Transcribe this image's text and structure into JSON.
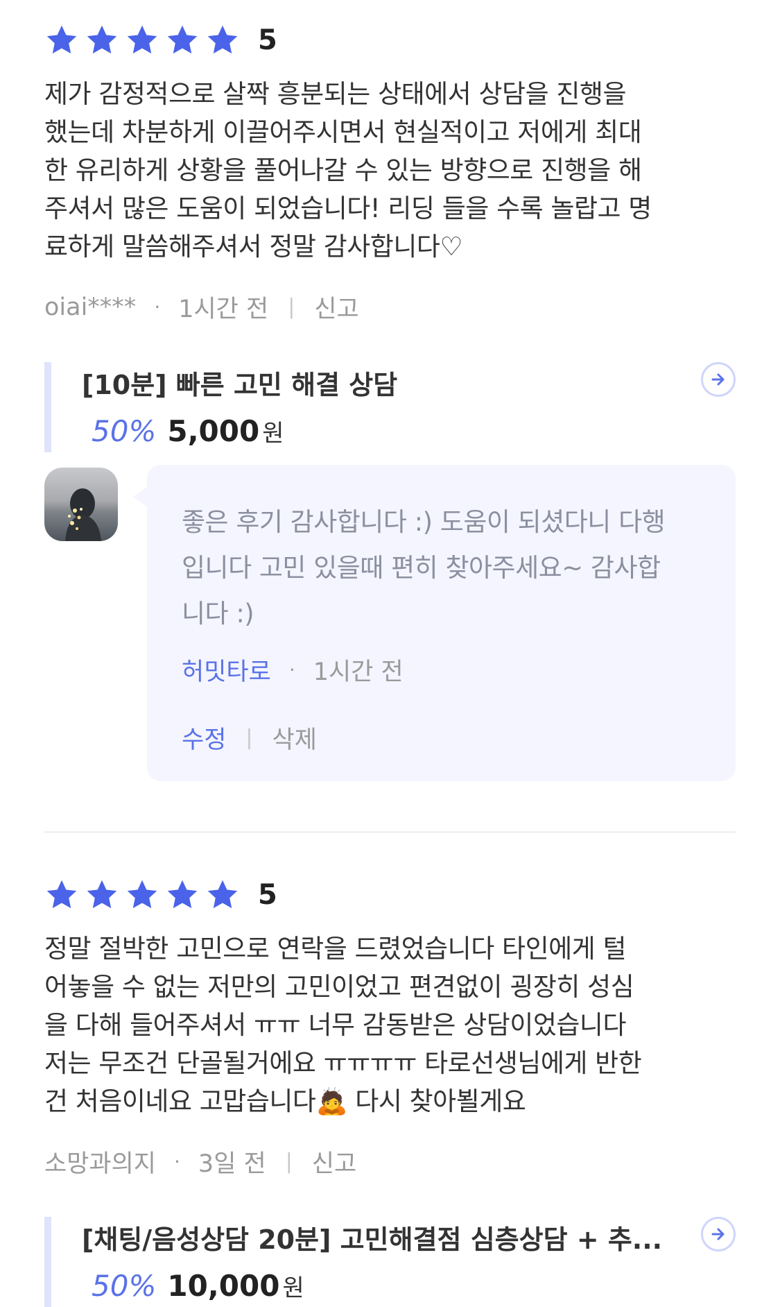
{
  "colors": {
    "star": "#4a63e8",
    "accent": "#5a72e8",
    "reply_bg": "#f4f5fe",
    "card_bar": "#dfe3fb"
  },
  "reviews": [
    {
      "stars": 5,
      "rating_label": "5",
      "text_lines": [
        "제가 감정적으로 살짝 흥분되는 상태에서 상담을 진행을",
        "했는데 차분하게 이끌어주시면서 현실적이고 저에게 최대",
        "한 유리하게 상황을 풀어나갈 수 있는 방향으로 진행을 해",
        "주셔서 많은 도움이 되었습니다! 리딩 들을 수록 놀랍고 명",
        "료하게 말씀해주셔서 정말 감사합니다♡"
      ],
      "author": "oiai****",
      "time": "1시간 전",
      "report_label": "신고",
      "product": {
        "title": "[10분] 빠른 고민 해결 상담",
        "discount": "50%",
        "price": "5,000",
        "currency": "원",
        "arrow_icon": "arrow-right-circle-icon"
      }
    },
    {
      "stars": 5,
      "rating_label": "5",
      "text_lines": [
        "정말 절박한 고민으로 연락을 드렸었습니다 타인에게 털",
        "어놓을 수 없는 저만의 고민이었고 편견없이 굉장히 성심",
        "을 다해 들어주셔서 ㅠㅠ 너무 감동받은 상담이었습니다",
        "저는 무조건 단골될거에요 ㅠㅠㅠㅠ 타로선생님에게 반한",
        "건 처음이네요 고맙습니다🙇 다시 찾아뵐게요"
      ],
      "author": "소망과의지",
      "time": "3일 전",
      "report_label": "신고",
      "product": {
        "title": "[채팅/음성상담 20분] 고민해결점 심층상담 + 추...",
        "discount": "50%",
        "price": "10,000",
        "currency": "원",
        "arrow_icon": "arrow-right-circle-icon"
      }
    }
  ],
  "reply": {
    "text_lines": [
      "좋은 후기 감사합니다 :) 도움이 되셨다니 다행",
      "입니다 고민 있을때 편히 찾아주세요~ 감사합",
      "니다 :)"
    ],
    "author": "허밋타로",
    "time": "1시간 전",
    "edit_label": "수정",
    "delete_label": "삭제"
  }
}
